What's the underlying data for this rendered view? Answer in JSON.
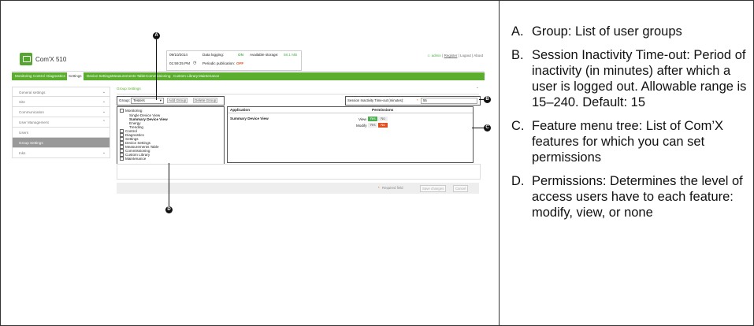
{
  "app": {
    "name": "Com'X 510",
    "date": "09/10/2014",
    "time": "01:59:25 PM",
    "data_logging_label": "Data logging:",
    "data_logging_value": "ON",
    "storage_label": "Available storage:",
    "storage_value": "58.1 MB",
    "periodic_label": "Periodic publication:",
    "periodic_value": "OFF",
    "admin": "admin",
    "register": "Register",
    "logout": "Logout",
    "about": "About"
  },
  "nav": [
    "Monitoring",
    "Control",
    "Diagnostics",
    "Settings",
    "Device Settings",
    "Measurements Table",
    "Commissioning",
    "Custom Library",
    "Maintenance"
  ],
  "sidebar": [
    "General settings",
    "Site",
    "Communication",
    "User Management",
    "Users",
    "Group Settings",
    "Inks"
  ],
  "main": {
    "title": "Group Settings",
    "group_label": "Group:",
    "group_value": "Testers",
    "add_group": "Add Group",
    "delete_group": "Delete Group",
    "session_label": "Session Inactivity Time-out (minutes):",
    "session_star": "*",
    "session_value": "55",
    "tree": [
      "Monitoring",
      "Single Device View",
      "Summary Device View",
      "Energy",
      "Trending",
      "Control",
      "Diagnostics",
      "Settings",
      "Device Settings",
      "Measurements Table",
      "Commissioning",
      "Custom Library",
      "Maintenance"
    ],
    "perm_app_header": "Application",
    "perm_perm_header": "Permissions",
    "perm_row": "Summary Device View",
    "view": "View",
    "modify": "Modify",
    "yes": "Yes",
    "no": "No",
    "required": "Required field",
    "required_star": "*",
    "save": "Save changes",
    "cancel": "Cancel"
  },
  "callouts": [
    "A",
    "B",
    "C",
    "D"
  ],
  "legend": [
    {
      "letter": "A.",
      "text": "Group: List of user groups"
    },
    {
      "letter": "B.",
      "text": "Session Inactivity Time-out: Period of inactivity (in minutes) after which a user is logged out. Allowable range is 15–240. Default: 15"
    },
    {
      "letter": "C.",
      "text": "Feature menu tree: List of Com’X features for which you can set permissions"
    },
    {
      "letter": "D.",
      "text": "Permissions: Determines the level of access users have to each feature: modify, view, or none"
    }
  ]
}
